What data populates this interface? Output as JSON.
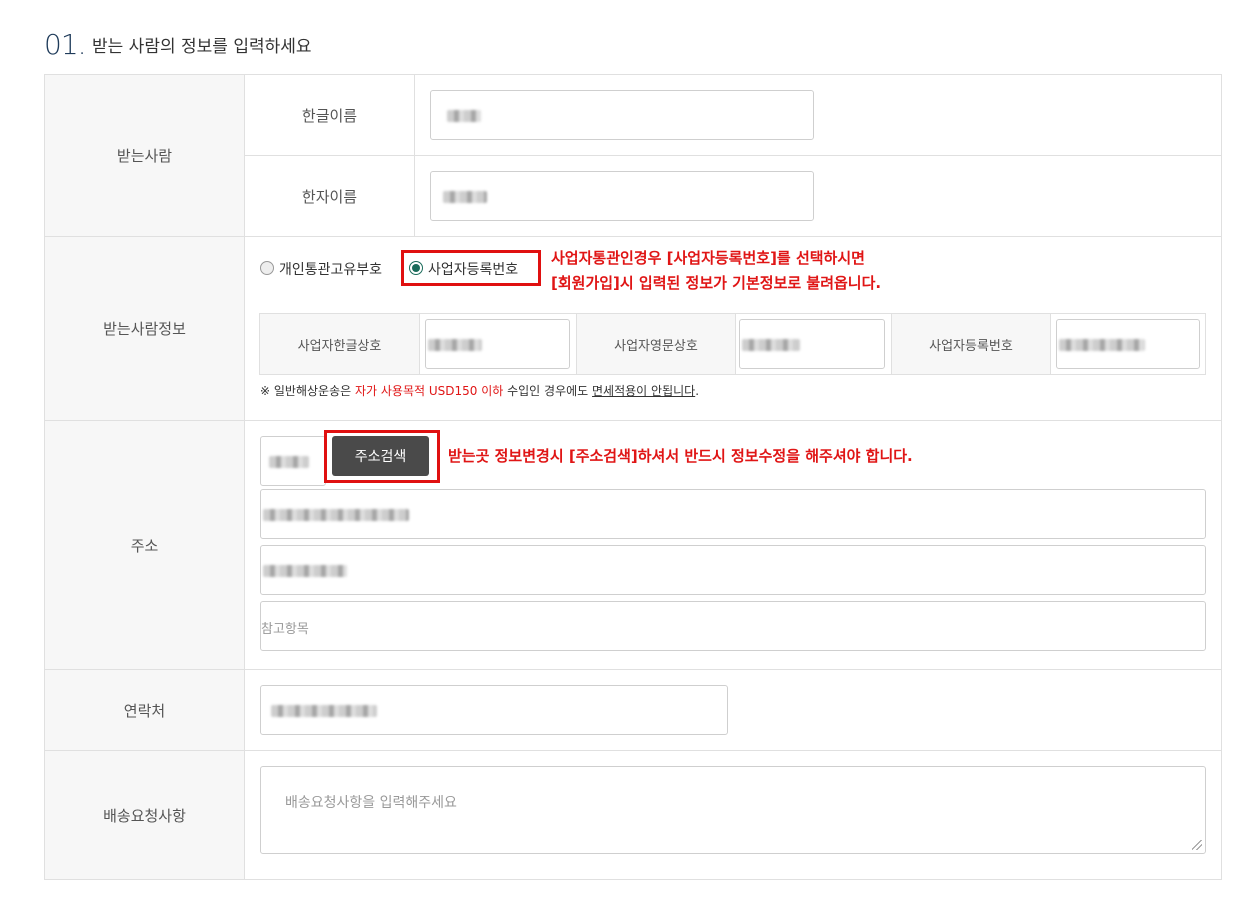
{
  "section": {
    "number": "01.",
    "title": "받는 사람의 정보를 입력하세요"
  },
  "recipient": {
    "label": "받는사람",
    "korean_name_label": "한글이름",
    "hanja_name_label": "한자이름"
  },
  "recipient_info": {
    "label": "받는사람정보",
    "option_personal": "개인통관고유부호",
    "option_business": "사업자등록번호",
    "selected": "사업자등록번호",
    "note_line1": "사업자통관인경우 [사업자등록번호]를 선택하시면",
    "note_line2": "[회원가입]시 입력된 정보가 기본정보로 불려옵니다.",
    "biz_korean_label": "사업자한글상호",
    "biz_english_label": "사업자영문상호",
    "biz_reg_label": "사업자등록번호",
    "notice_prefix": "※ 일반해상운송은 ",
    "notice_red": "자가 사용목적 USD150 이하",
    "notice_mid": " 수입인 경우에도 ",
    "notice_link": "면세적용이 안됩니다",
    "notice_end": "."
  },
  "address": {
    "label": "주소",
    "search_button": "주소검색",
    "note": "받는곳 정보변경시 [주소검색]하셔서 반드시 정보수정을 해주셔야 합니다.",
    "reference_placeholder": "참고항목"
  },
  "contact": {
    "label": "연락처"
  },
  "delivery": {
    "label": "배송요청사항",
    "placeholder": "배송요청사항을 입력해주세요"
  },
  "colors": {
    "accent_red": "#e01515",
    "radio_green": "#1a6b5a",
    "button_dark": "#4a4a4a",
    "title_navy": "#1f3b5a"
  }
}
